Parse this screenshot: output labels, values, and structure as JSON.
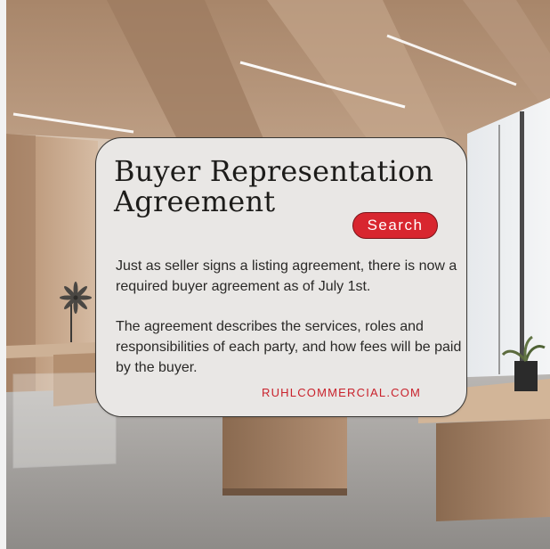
{
  "card": {
    "title": "Buyer Representation Agreement",
    "search_label": "Search",
    "paragraph_1": "Just as seller signs a listing agreement, there is now a required buyer agreement as of July 1st.",
    "paragraph_2": "The agreement describes the services, roles and responsibilities of each party, and how fees will be paid by the buyer.",
    "website": "RUHLCOMMERCIAL.COM"
  },
  "colors": {
    "accent": "#d8262f",
    "card_background": "#e9e7e5",
    "link": "#c9222c"
  },
  "icons": {
    "decor": "pinwheel-sculpture-icon"
  }
}
